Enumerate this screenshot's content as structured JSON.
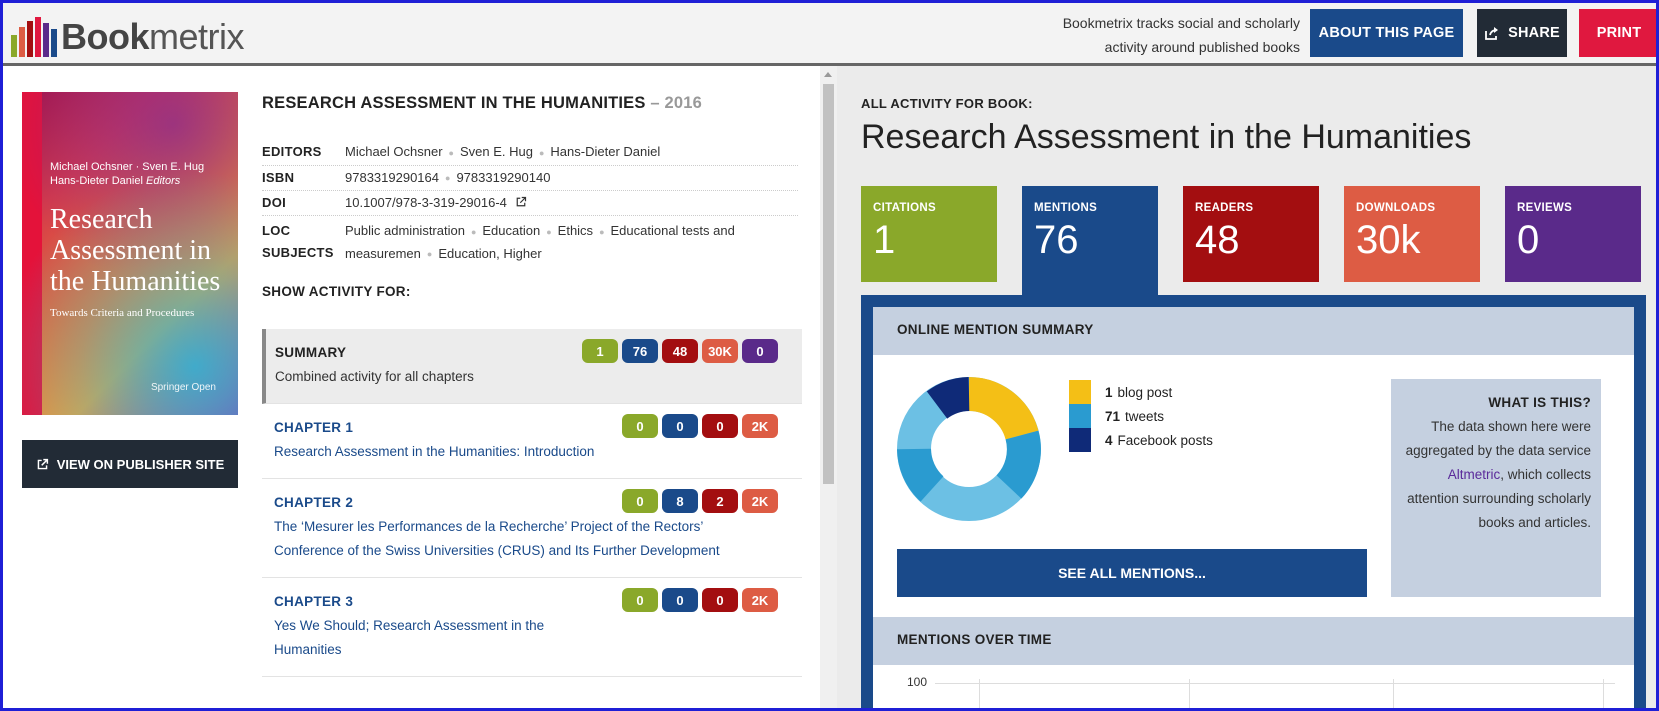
{
  "header": {
    "logo_bold": "Book",
    "logo_light": "metrix",
    "tagline_line1": "Bookmetrix tracks social and scholarly",
    "tagline_line2": "activity around published books",
    "about_label": "ABOUT THIS PAGE",
    "share_label": "SHARE",
    "print_label": "PRINT"
  },
  "cover": {
    "editors_line1": "Michael Ochsner · Sven E. Hug",
    "editors_line2": "Hans-Dieter Daniel",
    "editors_suffix": "Editors",
    "title": "Research Assessment in the Humanities",
    "subtitle": "Towards Criteria and Procedures",
    "publisher": "Springer Open"
  },
  "publisher_button": "VIEW ON PUBLISHER SITE",
  "book": {
    "title": "RESEARCH ASSESSMENT IN THE HUMANITIES",
    "year": "– 2016",
    "meta": {
      "editors_key": "EDITORS",
      "editors": [
        "Michael Ochsner",
        "Sven E. Hug",
        "Hans-Dieter Daniel"
      ],
      "isbn_key": "ISBN",
      "isbn": [
        "9783319290164",
        "9783319290140"
      ],
      "doi_key": "DOI",
      "doi": "10.1007/978-3-319-29016-4",
      "loc_key": "LOC",
      "subjects_key": "SUBJECTS",
      "loc_subjects": [
        "Public administration",
        "Education",
        "Ethics",
        "Educational tests and measuremen",
        "Education, Higher"
      ]
    },
    "show_activity_for": "SHOW ACTIVITY FOR:"
  },
  "chapters": [
    {
      "head": "SUMMARY",
      "desc": "Combined activity for all chapters",
      "badges": [
        "1",
        "76",
        "48",
        "30K",
        "0"
      ]
    },
    {
      "head": "CHAPTER 1",
      "desc": "Research Assessment in the Humanities: Introduction",
      "badges": [
        "0",
        "0",
        "0",
        "2K"
      ]
    },
    {
      "head": "CHAPTER 2",
      "desc": "The ‘Mesurer les Performances de la Recherche’ Project of the Rectors’ Conference of the Swiss Universities (CRUS) and Its Further Development",
      "badges": [
        "0",
        "8",
        "2",
        "2K"
      ]
    },
    {
      "head": "CHAPTER 3",
      "desc": "Yes We Should; Research Assessment in the Humanities",
      "badges": [
        "0",
        "0",
        "0",
        "2K"
      ]
    }
  ],
  "activity": {
    "all_for_label": "ALL ACTIVITY FOR BOOK:",
    "title": "Research Assessment in the Humanities",
    "tiles": [
      {
        "label": "CITATIONS",
        "value": "1",
        "color": "#8aa82a"
      },
      {
        "label": "MENTIONS",
        "value": "76",
        "color": "#1a4a8a"
      },
      {
        "label": "READERS",
        "value": "48",
        "color": "#a30e10"
      },
      {
        "label": "DOWNLOADS",
        "value": "30k",
        "color": "#dd5c44"
      },
      {
        "label": "REVIEWS",
        "value": "0",
        "color": "#5a2a8a"
      }
    ],
    "summary_heading": "ONLINE MENTION SUMMARY",
    "legend": [
      {
        "count": "1",
        "label": "blog post",
        "color": "#f4bf16"
      },
      {
        "count": "71",
        "label": "tweets",
        "color": "#2a9bd0"
      },
      {
        "count": "4",
        "label": "Facebook posts",
        "color": "#0f2a78"
      }
    ],
    "see_all_label": "SEE ALL MENTIONS...",
    "what_title": "WHAT IS THIS?",
    "what_text_before": "The data shown here were aggregated by the data service",
    "what_link": "Altmetric",
    "what_text_after": ", which collects attention surrounding scholarly books and articles.",
    "over_time_heading": "MENTIONS OVER TIME",
    "axis_top": "100"
  },
  "colors": {
    "green": "#8aa82a",
    "blue": "#1a4a8a",
    "red": "#a30e10",
    "orange": "#dd5c44",
    "purple": "#5a2a8a"
  }
}
